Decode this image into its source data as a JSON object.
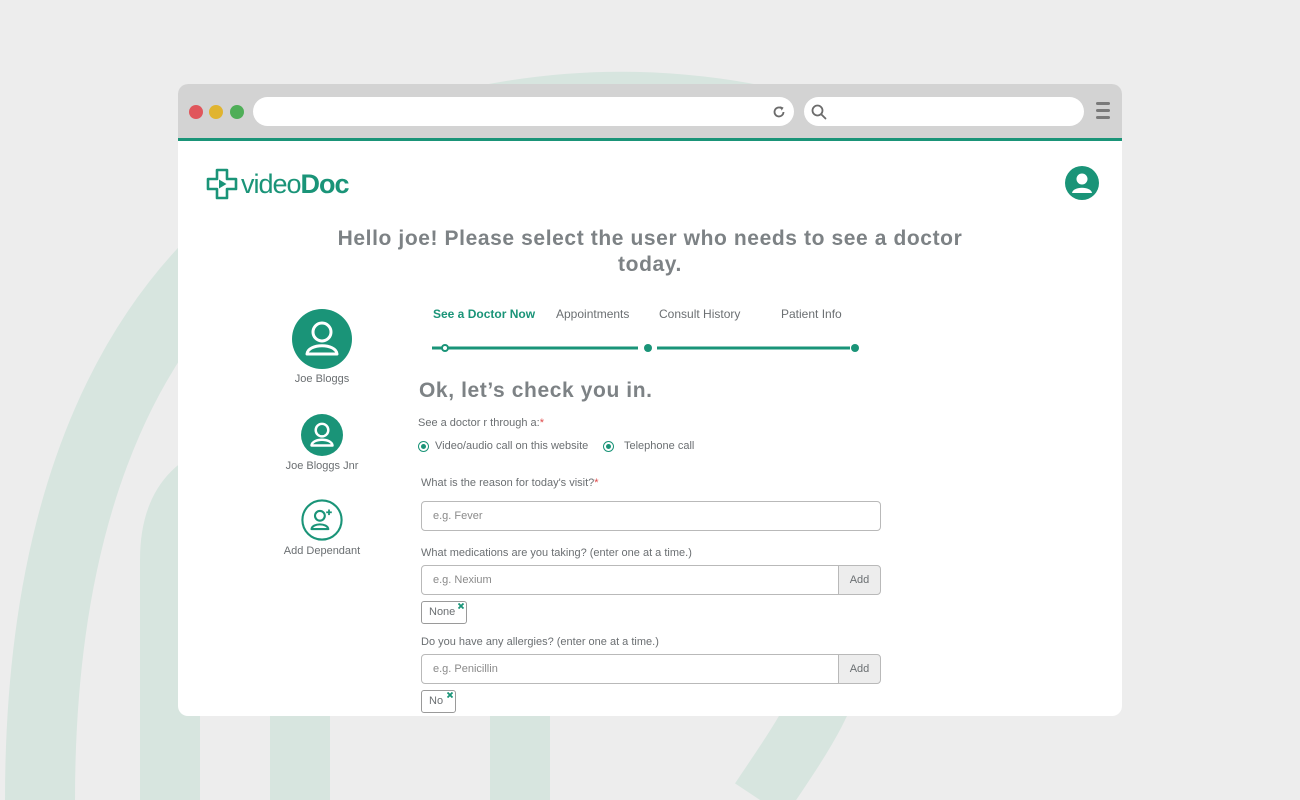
{
  "brand": {
    "name_part1": "video",
    "name_part2": "Doc",
    "accent": "#1a9478"
  },
  "greeting": "Hello joe! Please select the user who needs to see a doctor today.",
  "users": [
    {
      "label": "Joe Bloggs",
      "icon": "user-avatar-icon"
    },
    {
      "label": "Joe Bloggs Jnr",
      "icon": "user-avatar-icon"
    },
    {
      "label": "Add Dependant",
      "icon": "add-user-icon"
    }
  ],
  "tabs": [
    {
      "label": "See a Doctor Now",
      "active": true
    },
    {
      "label": "Appointments",
      "active": false
    },
    {
      "label": "Consult History",
      "active": false
    },
    {
      "label": "Patient Info",
      "active": false
    }
  ],
  "checkin": {
    "title": "Ok, let’s check you in.",
    "method_label": "See a doctor r through a:",
    "required_mark": "*",
    "options": [
      {
        "label": "Video/audio call on this website"
      },
      {
        "label": "Telephone call"
      }
    ],
    "reason_label": "What is the reason for today's visit?",
    "reason_placeholder": "e.g. Fever",
    "medications_label": "What medications are you taking? (enter one at a time.)",
    "medications_placeholder": "e.g. Nexium",
    "medications_tags": [
      "None"
    ],
    "allergies_label": "Do you have any allergies? (enter one at a time.)",
    "allergies_placeholder": "e.g. Penicillin",
    "allergies_tags": [
      "No"
    ],
    "add_label": "Add"
  }
}
